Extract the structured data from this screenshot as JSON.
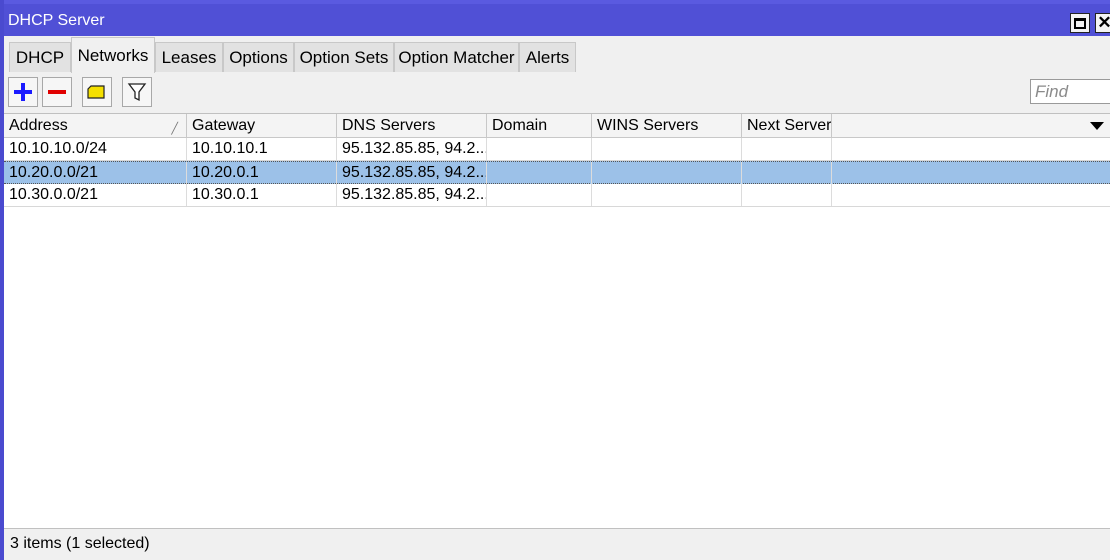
{
  "window": {
    "title": "DHCP Server"
  },
  "tabs": [
    {
      "label": "DHCP"
    },
    {
      "label": "Networks",
      "active": true
    },
    {
      "label": "Leases"
    },
    {
      "label": "Options"
    },
    {
      "label": "Option Sets"
    },
    {
      "label": "Option Matcher"
    },
    {
      "label": "Alerts"
    }
  ],
  "toolbar": {
    "icons": [
      "add-icon",
      "remove-icon",
      "comment-icon",
      "filter-icon"
    ],
    "find_placeholder": "Find"
  },
  "table": {
    "columns": [
      "Address",
      "Gateway",
      "DNS Servers",
      "Domain",
      "WINS Servers",
      "Next Server"
    ],
    "rows": [
      {
        "address": "10.10.10.0/24",
        "gateway": "10.10.10.1",
        "dns": "95.132.85.85, 94.2...",
        "domain": "",
        "wins": "",
        "next": ""
      },
      {
        "address": "10.20.0.0/21",
        "gateway": "10.20.0.1",
        "dns": "95.132.85.85, 94.2...",
        "domain": "",
        "wins": "",
        "next": "",
        "selected": true
      },
      {
        "address": "10.30.0.0/21",
        "gateway": "10.30.0.1",
        "dns": "95.132.85.85, 94.2...",
        "domain": "",
        "wins": "",
        "next": ""
      }
    ]
  },
  "status": {
    "text": "3 items (1 selected)"
  },
  "colors": {
    "titlebar": "#5050d6",
    "selection": "#9cc1e8",
    "add": "#1a1aff",
    "remove": "#e00000",
    "comment": "#f5e000"
  }
}
